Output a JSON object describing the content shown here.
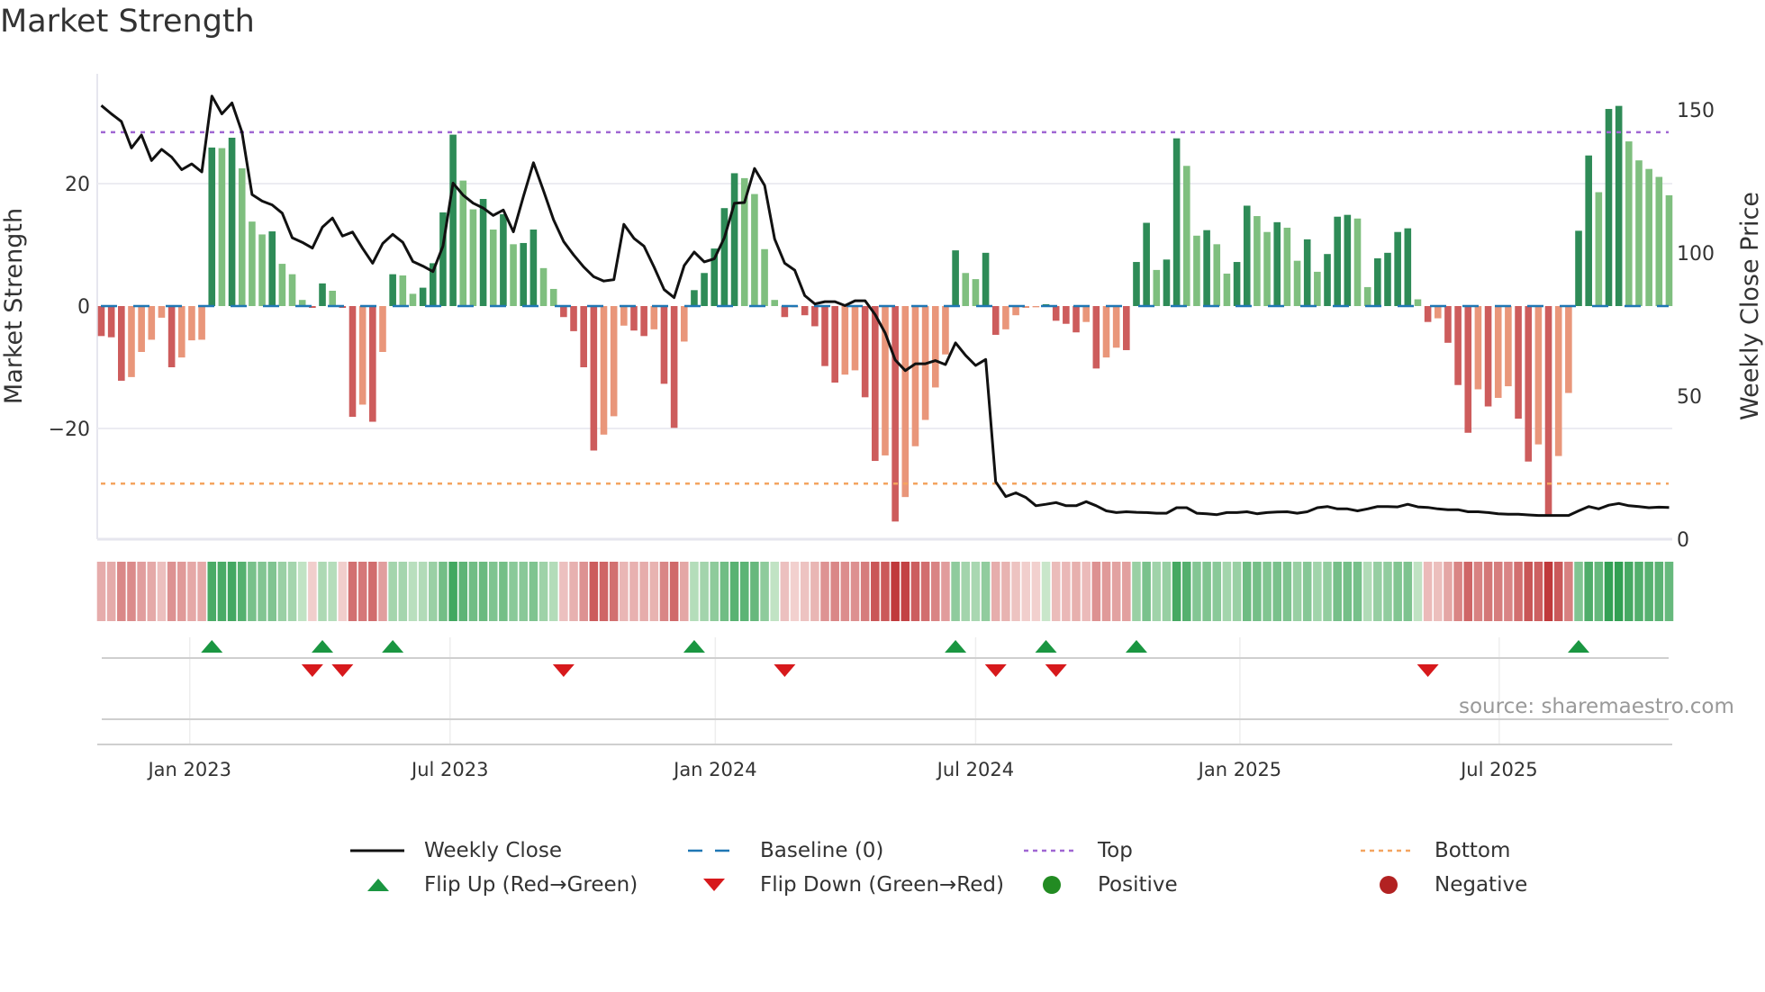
{
  "title": "Market Strength",
  "source": "source: sharemaestro.com",
  "colors": {
    "pos_dark": "#2e8b57",
    "pos_light": "#7fbf7f",
    "neg_dark": "#cd5c5c",
    "neg_light": "#e9967a",
    "price": "#111111",
    "baseline": "#1f77b4",
    "top": "#a066d3",
    "bottom": "#f4a460",
    "flip_up": "#1a9641",
    "flip_down": "#d7191c",
    "positive": "#228b22",
    "negative": "#b22222"
  },
  "legend": [
    {
      "label": "Weekly Close",
      "kind": "line"
    },
    {
      "label": "Baseline (0)",
      "kind": "dash"
    },
    {
      "label": "Top",
      "kind": "dot-purple"
    },
    {
      "label": "Bottom",
      "kind": "dot-orange"
    },
    {
      "label": "Flip Up (Red→Green)",
      "kind": "tri-up"
    },
    {
      "label": "Flip Down (Green→Red)",
      "kind": "tri-down"
    },
    {
      "label": "Positive",
      "kind": "dot-green"
    },
    {
      "label": "Negative",
      "kind": "dot-red"
    }
  ],
  "chart_data": {
    "type": "bar",
    "title": "Market Strength",
    "xlabel": "",
    "ylabel": "Market Strength",
    "y2label": "Weekly Close Price",
    "ylim": [
      -38,
      38
    ],
    "y2lim": [
      0,
      163
    ],
    "yticks": [
      {
        "v": 20,
        "label": "20"
      },
      {
        "v": 0,
        "label": "0"
      },
      {
        "v": -20,
        "label": "−20"
      }
    ],
    "y2ticks": [
      {
        "v": 150,
        "label": "150"
      },
      {
        "v": 100,
        "label": "100"
      },
      {
        "v": 50,
        "label": "50"
      },
      {
        "v": 0,
        "label": "0"
      }
    ],
    "xticks": [
      {
        "week": 9.8,
        "label": "Jan 2023"
      },
      {
        "week": 35.7,
        "label": "Jul 2023"
      },
      {
        "week": 62.1,
        "label": "Jan 2024"
      },
      {
        "week": 88.0,
        "label": "Jul 2024"
      },
      {
        "week": 114.3,
        "label": "Jan 2025"
      },
      {
        "week": 140.1,
        "label": "Jul 2025"
      }
    ],
    "top_level": 28.4,
    "bottom_level": -29,
    "strength": [
      -4.9,
      -5.1,
      -12.2,
      -11.6,
      -7.5,
      -5.5,
      -1.9,
      -10,
      -8.4,
      -5.6,
      -5.5,
      25.9,
      25.8,
      27.5,
      22.5,
      13.8,
      11.7,
      12.2,
      6.9,
      5.2,
      1,
      -0.3,
      3.7,
      2.5,
      -0.3,
      -18.1,
      -16.1,
      -18.9,
      -7.5,
      5.2,
      5,
      2,
      3,
      7,
      15.3,
      28,
      20.5,
      15.8,
      17.5,
      12.5,
      15,
      10.1,
      10.3,
      12.5,
      6.2,
      2.8,
      -1.8,
      -4.1,
      -10,
      -23.6,
      -21,
      -18,
      -3.2,
      -4,
      -4.9,
      -3.8,
      -12.7,
      -19.9,
      -5.8,
      2.6,
      5.4,
      9.4,
      16,
      21.7,
      20.9,
      18.3,
      9.3,
      1,
      -1.8,
      -0.2,
      -1.5,
      -3.3,
      -9.8,
      -12.5,
      -11.2,
      -10.5,
      -14.9,
      -25.3,
      -24.4,
      -35.2,
      -31.2,
      -22.9,
      -18.6,
      -13.3,
      -7.9,
      9.1,
      5.4,
      4.4,
      8.7,
      -4.7,
      -3.8,
      -1.5,
      -0.3,
      -0.2,
      0.3,
      -2.4,
      -2.9,
      -4.3,
      -2.6,
      -10.2,
      -8.4,
      -6.8,
      -7.2,
      7.2,
      13.6,
      5.9,
      7.6,
      27.4,
      22.9,
      11.5,
      12.4,
      10.1,
      5.3,
      7.2,
      16.4,
      14.7,
      12.1,
      13.7,
      12.8,
      7.4,
      10.9,
      5.6,
      8.5,
      14.6,
      14.9,
      14.3,
      3.1,
      7.8,
      8.7,
      12.1,
      12.7,
      1.1,
      -2.6,
      -2,
      -6,
      -12.9,
      -20.7,
      -13.6,
      -16.4,
      -15,
      -13.1,
      -18.4,
      -25.4,
      -22.6,
      -34.2,
      -24.5,
      -14.2,
      12.3,
      24.6,
      18.6,
      32.2,
      32.7,
      26.9,
      23.8,
      22.4,
      21.1,
      18.1
    ],
    "weekly_close": [
      151.5,
      148.6,
      145.9,
      136.7,
      141.2,
      132.3,
      136.2,
      133.5,
      129.1,
      131.1,
      128.3,
      154.8,
      148.6,
      152.4,
      142.2,
      120.4,
      118.1,
      116.8,
      113.9,
      105.3,
      103.7,
      101.7,
      109,
      112.2,
      105.9,
      107.3,
      101.6,
      96.4,
      103.3,
      106.5,
      103.7,
      97,
      95.4,
      93.5,
      102.4,
      124.4,
      120.2,
      117.4,
      115.7,
      113.1,
      115,
      107.4,
      119.7,
      131.5,
      121.8,
      111.6,
      104,
      99.3,
      95.1,
      91.7,
      90.2,
      90.7,
      110,
      105.1,
      102.4,
      95.1,
      87.2,
      84.4,
      95.6,
      100.3,
      96.9,
      98,
      105.3,
      117.4,
      117.6,
      129.5,
      123.6,
      104.9,
      96.4,
      94,
      85.1,
      82.2,
      83,
      83,
      81.6,
      83.3,
      83.3,
      78.5,
      72,
      62.6,
      58.9,
      61.3,
      61.3,
      62.4,
      61,
      68.6,
      64.2,
      60.7,
      62.8,
      20.1,
      14.9,
      16.2,
      14.6,
      11.7,
      12.2,
      12.8,
      11.7,
      11.7,
      13.1,
      11.7,
      9.9,
      9.3,
      9.6,
      9.4,
      9.3,
      9.1,
      9.1,
      11,
      11,
      9.1,
      8.9,
      8.6,
      9.3,
      9.3,
      9.6,
      8.9,
      9.3,
      9.5,
      9.6,
      9.1,
      9.6,
      11,
      11.4,
      10.6,
      10.6,
      9.9,
      10.6,
      11.4,
      11.4,
      11.3,
      12.2,
      11.3,
      11.1,
      10.6,
      10.3,
      10.3,
      9.6,
      9.6,
      9.3,
      8.9,
      8.7,
      8.7,
      8.5,
      8.3,
      8.3,
      8.3,
      8.3,
      9.9,
      11.4,
      10.6,
      11.9,
      12.5,
      11.7,
      11.4,
      11,
      11.2,
      11.1
    ],
    "flip_up_weeks": [
      12,
      23,
      30,
      60,
      86,
      95,
      104,
      148
    ],
    "flip_down_weeks": [
      22,
      25,
      47,
      69,
      90,
      96,
      133
    ],
    "grid": true,
    "legend_position": "bottom"
  }
}
